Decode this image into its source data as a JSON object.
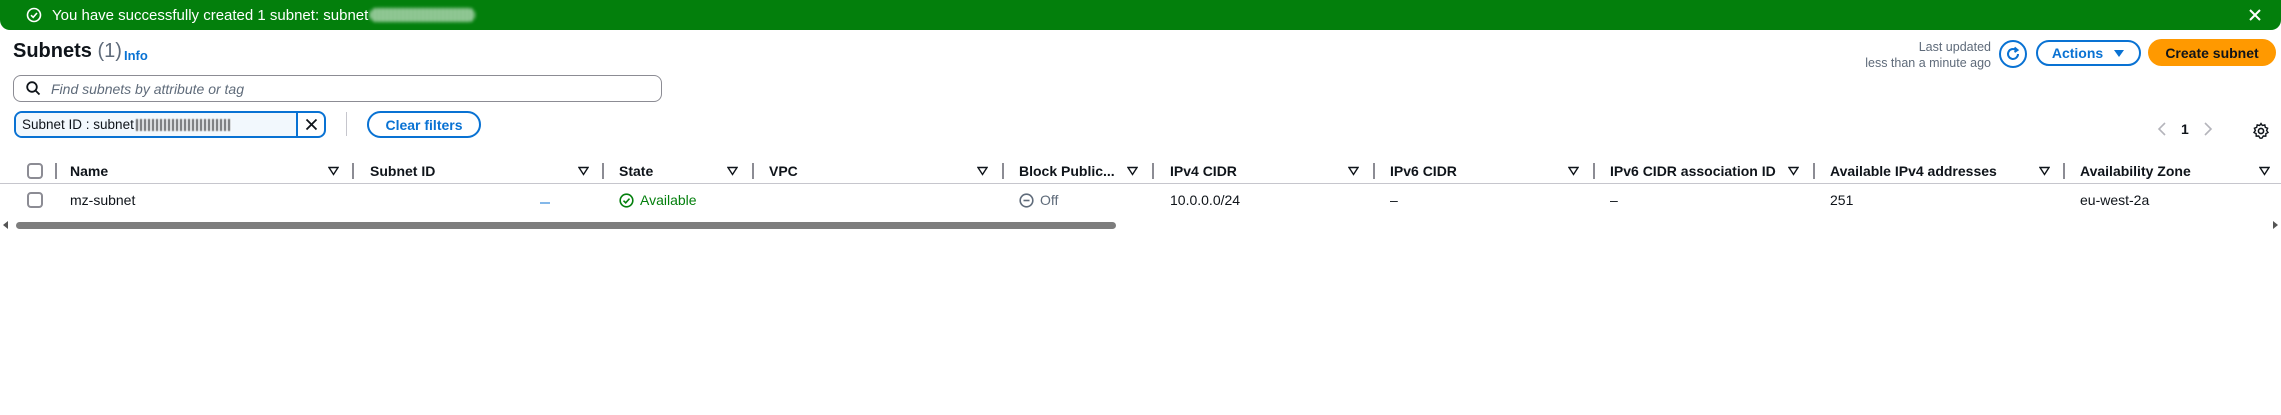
{
  "flash": {
    "message": "You have successfully created 1 subnet: subnet",
    "icons": [
      "check-circle-icon",
      "close-icon"
    ]
  },
  "header": {
    "title": "Subnets",
    "count": "(1)",
    "info": "Info",
    "last_updated_line1": "Last updated",
    "last_updated_line2": "less than a minute ago",
    "actions_label": "Actions",
    "create_label": "Create subnet",
    "accent_color": "#0972d3",
    "primary_color": "#ff9900"
  },
  "search": {
    "placeholder": "Find subnets by attribute or tag"
  },
  "filter_token": {
    "text": "Subnet ID : subnet"
  },
  "clear_filters_label": "Clear filters",
  "pagination": {
    "current_page": "1"
  },
  "table": {
    "columns": [
      "Name",
      "Subnet ID",
      "State",
      "VPC",
      "Block Public...",
      "IPv4 CIDR",
      "IPv6 CIDR",
      "IPv6 CIDR association ID",
      "Available IPv4 addresses",
      "Availability Zone"
    ],
    "rows": [
      {
        "name": "mz-subnet",
        "subnet_id": "",
        "state": "Available",
        "vpc": "",
        "block_public": "Off",
        "ipv4_cidr": "10.0.0.0/24",
        "ipv6_cidr": "–",
        "ipv6_assoc": "–",
        "available_ipv4": "251",
        "az": "eu-west-2a"
      }
    ]
  },
  "colors": {
    "success_green": "#037f0c",
    "text": "#0f141a",
    "muted": "#5f6b7a"
  }
}
